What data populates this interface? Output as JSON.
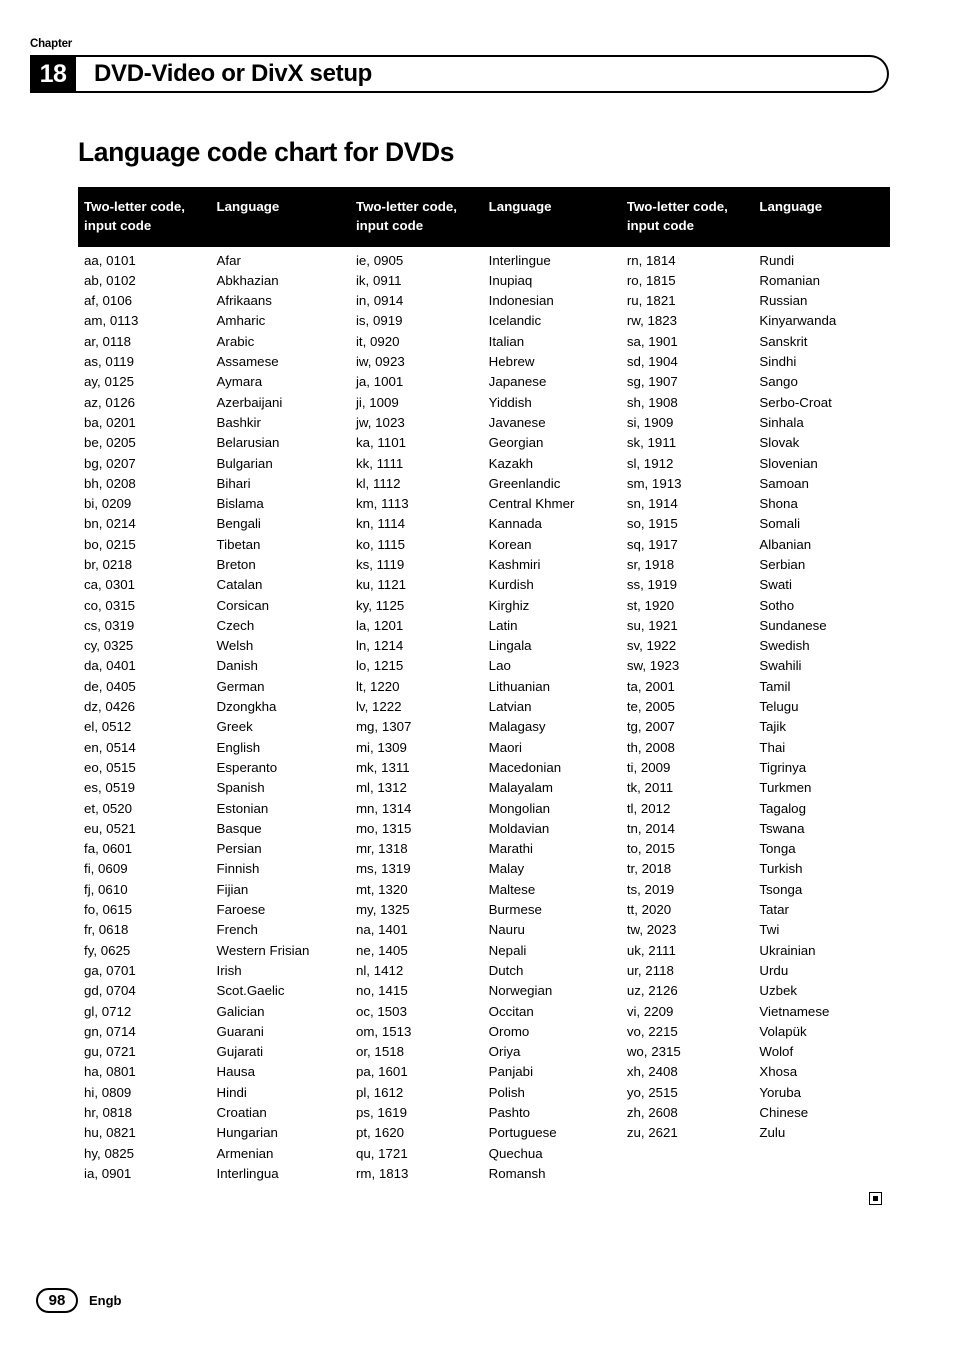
{
  "header": {
    "chapter_label": "Chapter",
    "chapter_number": "18",
    "chapter_title": "DVD-Video or DivX setup"
  },
  "page_title": "Language code chart for DVDs",
  "table": {
    "headers": {
      "code": "Two-letter code, input code",
      "language": "Language"
    },
    "columns": [
      {
        "rows": [
          {
            "code": "aa, 0101",
            "language": "Afar"
          },
          {
            "code": "ab, 0102",
            "language": "Abkhazian"
          },
          {
            "code": "af, 0106",
            "language": "Afrikaans"
          },
          {
            "code": "am, 0113",
            "language": "Amharic"
          },
          {
            "code": "ar, 0118",
            "language": "Arabic"
          },
          {
            "code": "as, 0119",
            "language": "Assamese"
          },
          {
            "code": "ay, 0125",
            "language": "Aymara"
          },
          {
            "code": "az, 0126",
            "language": "Azerbaijani"
          },
          {
            "code": "ba, 0201",
            "language": "Bashkir"
          },
          {
            "code": "be, 0205",
            "language": "Belarusian"
          },
          {
            "code": "bg, 0207",
            "language": "Bulgarian"
          },
          {
            "code": "bh, 0208",
            "language": "Bihari"
          },
          {
            "code": "bi, 0209",
            "language": "Bislama"
          },
          {
            "code": "bn, 0214",
            "language": "Bengali"
          },
          {
            "code": "bo, 0215",
            "language": "Tibetan"
          },
          {
            "code": "br, 0218",
            "language": "Breton"
          },
          {
            "code": "ca, 0301",
            "language": "Catalan"
          },
          {
            "code": "co, 0315",
            "language": "Corsican"
          },
          {
            "code": "cs, 0319",
            "language": "Czech"
          },
          {
            "code": "cy, 0325",
            "language": "Welsh"
          },
          {
            "code": "da, 0401",
            "language": "Danish"
          },
          {
            "code": "de, 0405",
            "language": "German"
          },
          {
            "code": "dz, 0426",
            "language": "Dzongkha"
          },
          {
            "code": "el, 0512",
            "language": "Greek"
          },
          {
            "code": "en, 0514",
            "language": "English"
          },
          {
            "code": "eo, 0515",
            "language": "Esperanto"
          },
          {
            "code": "es, 0519",
            "language": "Spanish"
          },
          {
            "code": "et, 0520",
            "language": "Estonian"
          },
          {
            "code": "eu, 0521",
            "language": "Basque"
          },
          {
            "code": "fa, 0601",
            "language": "Persian"
          },
          {
            "code": "fi, 0609",
            "language": "Finnish"
          },
          {
            "code": "fj, 0610",
            "language": "Fijian"
          },
          {
            "code": "fo, 0615",
            "language": "Faroese"
          },
          {
            "code": "fr, 0618",
            "language": "French"
          },
          {
            "code": "fy, 0625",
            "language": "Western Frisian"
          },
          {
            "code": "ga, 0701",
            "language": "Irish"
          },
          {
            "code": "gd, 0704",
            "language": "Scot.Gaelic"
          },
          {
            "code": "gl, 0712",
            "language": "Galician"
          },
          {
            "code": "gn, 0714",
            "language": "Guarani"
          },
          {
            "code": "gu, 0721",
            "language": "Gujarati"
          },
          {
            "code": "ha, 0801",
            "language": "Hausa"
          },
          {
            "code": "hi, 0809",
            "language": "Hindi"
          },
          {
            "code": "hr, 0818",
            "language": "Croatian"
          },
          {
            "code": "hu, 0821",
            "language": "Hungarian"
          },
          {
            "code": "hy, 0825",
            "language": "Armenian"
          },
          {
            "code": "ia, 0901",
            "language": "Interlingua"
          }
        ]
      },
      {
        "rows": [
          {
            "code": "ie, 0905",
            "language": "Interlingue"
          },
          {
            "code": "ik, 0911",
            "language": "Inupiaq"
          },
          {
            "code": "in, 0914",
            "language": "Indonesian"
          },
          {
            "code": "is, 0919",
            "language": "Icelandic"
          },
          {
            "code": "it, 0920",
            "language": "Italian"
          },
          {
            "code": "iw, 0923",
            "language": "Hebrew"
          },
          {
            "code": "ja, 1001",
            "language": "Japanese"
          },
          {
            "code": "ji, 1009",
            "language": "Yiddish"
          },
          {
            "code": "jw, 1023",
            "language": "Javanese"
          },
          {
            "code": "ka, 1101",
            "language": "Georgian"
          },
          {
            "code": "kk, 1111",
            "language": "Kazakh"
          },
          {
            "code": "kl, 1112",
            "language": "Greenlandic"
          },
          {
            "code": "km, 1113",
            "language": "Central Khmer"
          },
          {
            "code": "kn, 1114",
            "language": "Kannada"
          },
          {
            "code": "ko, 1115",
            "language": "Korean"
          },
          {
            "code": "ks, 1119",
            "language": "Kashmiri"
          },
          {
            "code": "ku, 1121",
            "language": "Kurdish"
          },
          {
            "code": "ky, 1125",
            "language": "Kirghiz"
          },
          {
            "code": "la, 1201",
            "language": "Latin"
          },
          {
            "code": "ln, 1214",
            "language": "Lingala"
          },
          {
            "code": "lo, 1215",
            "language": "Lao"
          },
          {
            "code": "lt, 1220",
            "language": "Lithuanian"
          },
          {
            "code": "lv, 1222",
            "language": "Latvian"
          },
          {
            "code": "mg, 1307",
            "language": "Malagasy"
          },
          {
            "code": "mi, 1309",
            "language": "Maori"
          },
          {
            "code": "mk, 1311",
            "language": "Macedonian"
          },
          {
            "code": "ml, 1312",
            "language": "Malayalam"
          },
          {
            "code": "mn, 1314",
            "language": "Mongolian"
          },
          {
            "code": "mo, 1315",
            "language": "Moldavian"
          },
          {
            "code": "mr, 1318",
            "language": "Marathi"
          },
          {
            "code": "ms, 1319",
            "language": "Malay"
          },
          {
            "code": "mt, 1320",
            "language": "Maltese"
          },
          {
            "code": "my, 1325",
            "language": "Burmese"
          },
          {
            "code": "na, 1401",
            "language": "Nauru"
          },
          {
            "code": "ne, 1405",
            "language": "Nepali"
          },
          {
            "code": "nl, 1412",
            "language": "Dutch"
          },
          {
            "code": "no, 1415",
            "language": "Norwegian"
          },
          {
            "code": "oc, 1503",
            "language": "Occitan"
          },
          {
            "code": "om, 1513",
            "language": "Oromo"
          },
          {
            "code": "or, 1518",
            "language": "Oriya"
          },
          {
            "code": "pa, 1601",
            "language": "Panjabi"
          },
          {
            "code": "pl, 1612",
            "language": "Polish"
          },
          {
            "code": "ps, 1619",
            "language": "Pashto"
          },
          {
            "code": "pt, 1620",
            "language": "Portuguese"
          },
          {
            "code": "qu, 1721",
            "language": "Quechua"
          },
          {
            "code": "rm, 1813",
            "language": "Romansh"
          }
        ]
      },
      {
        "rows": [
          {
            "code": "rn, 1814",
            "language": "Rundi"
          },
          {
            "code": "ro, 1815",
            "language": "Romanian"
          },
          {
            "code": "ru, 1821",
            "language": "Russian"
          },
          {
            "code": "rw, 1823",
            "language": "Kinyarwanda"
          },
          {
            "code": "sa, 1901",
            "language": "Sanskrit"
          },
          {
            "code": "sd, 1904",
            "language": "Sindhi"
          },
          {
            "code": "sg, 1907",
            "language": "Sango"
          },
          {
            "code": "sh, 1908",
            "language": "Serbo-Croat"
          },
          {
            "code": "si, 1909",
            "language": "Sinhala"
          },
          {
            "code": "sk, 1911",
            "language": "Slovak"
          },
          {
            "code": "sl, 1912",
            "language": "Slovenian"
          },
          {
            "code": "sm, 1913",
            "language": "Samoan"
          },
          {
            "code": "sn, 1914",
            "language": "Shona"
          },
          {
            "code": "so, 1915",
            "language": "Somali"
          },
          {
            "code": "sq, 1917",
            "language": "Albanian"
          },
          {
            "code": "sr, 1918",
            "language": "Serbian"
          },
          {
            "code": "ss, 1919",
            "language": "Swati"
          },
          {
            "code": "st, 1920",
            "language": "Sotho"
          },
          {
            "code": "su, 1921",
            "language": "Sundanese"
          },
          {
            "code": "sv, 1922",
            "language": "Swedish"
          },
          {
            "code": "sw, 1923",
            "language": "Swahili"
          },
          {
            "code": "ta, 2001",
            "language": "Tamil"
          },
          {
            "code": "te, 2005",
            "language": "Telugu"
          },
          {
            "code": "tg, 2007",
            "language": "Tajik"
          },
          {
            "code": "th, 2008",
            "language": "Thai"
          },
          {
            "code": "ti, 2009",
            "language": "Tigrinya"
          },
          {
            "code": "tk, 2011",
            "language": "Turkmen"
          },
          {
            "code": "tl, 2012",
            "language": "Tagalog"
          },
          {
            "code": "tn, 2014",
            "language": "Tswana"
          },
          {
            "code": "to, 2015",
            "language": "Tonga"
          },
          {
            "code": "tr, 2018",
            "language": "Turkish"
          },
          {
            "code": "ts, 2019",
            "language": "Tsonga"
          },
          {
            "code": "tt, 2020",
            "language": "Tatar"
          },
          {
            "code": "tw, 2023",
            "language": "Twi"
          },
          {
            "code": "uk, 2111",
            "language": "Ukrainian"
          },
          {
            "code": "ur, 2118",
            "language": "Urdu"
          },
          {
            "code": "uz, 2126",
            "language": "Uzbek"
          },
          {
            "code": "vi, 2209",
            "language": "Vietnamese"
          },
          {
            "code": "vo, 2215",
            "language": "Volapük"
          },
          {
            "code": "wo, 2315",
            "language": "Wolof"
          },
          {
            "code": "xh, 2408",
            "language": "Xhosa"
          },
          {
            "code": "yo, 2515",
            "language": "Yoruba"
          },
          {
            "code": "zh, 2608",
            "language": "Chinese"
          },
          {
            "code": "zu, 2621",
            "language": "Zulu"
          },
          {
            "code": "",
            "language": ""
          },
          {
            "code": "",
            "language": ""
          }
        ]
      }
    ]
  },
  "footer": {
    "page_number": "98",
    "language_code": "Engb"
  }
}
